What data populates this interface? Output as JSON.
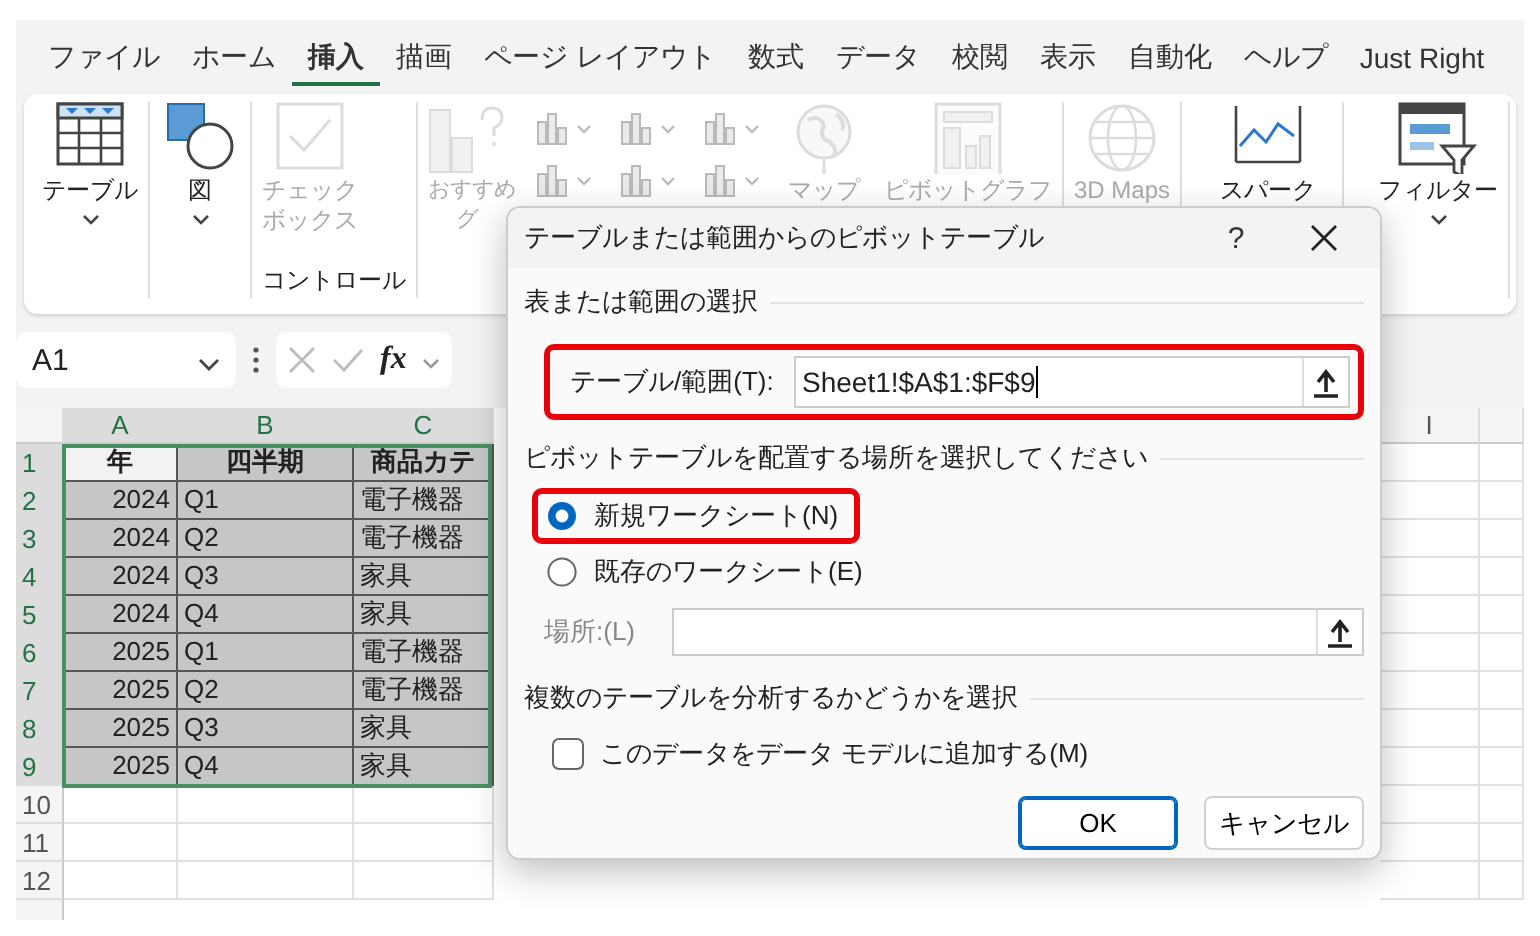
{
  "menu_tabs": [
    {
      "label": "ファイル",
      "selected": false
    },
    {
      "label": "ホーム",
      "selected": false
    },
    {
      "label": "挿入",
      "selected": true
    },
    {
      "label": "描画",
      "selected": false
    },
    {
      "label": "ページ レイアウト",
      "selected": false
    },
    {
      "label": "数式",
      "selected": false
    },
    {
      "label": "データ",
      "selected": false
    },
    {
      "label": "校閲",
      "selected": false
    },
    {
      "label": "表示",
      "selected": false
    },
    {
      "label": "自動化",
      "selected": false
    },
    {
      "label": "ヘルプ",
      "selected": false
    },
    {
      "label": "Just Right",
      "selected": false
    }
  ],
  "ribbon": {
    "groups": [
      {
        "items": [
          {
            "kind": "table",
            "lines": [
              "テーブル"
            ],
            "dropdown": true,
            "disabled": false
          }
        ]
      },
      {
        "items": [
          {
            "kind": "shapes",
            "lines": [
              "図"
            ],
            "dropdown": true,
            "disabled": false
          }
        ]
      },
      {
        "label": "コントロール",
        "items": [
          {
            "kind": "checkbox",
            "lines": [
              "チェック",
              "ボックス"
            ],
            "dropdown": false,
            "disabled": true
          }
        ]
      },
      {
        "items": [
          {
            "kind": "recommended-chart",
            "lines": [
              "おすすめ",
              "グ"
            ],
            "dropdown": false,
            "disabled": true
          },
          {
            "kind": "chart-grid",
            "dropdown": false,
            "disabled": true
          },
          {
            "kind": "globe",
            "lines": [
              "マップ"
            ],
            "dropdown": false,
            "disabled": true
          },
          {
            "kind": "pivot-chart",
            "lines": [
              "ピボットグラフ"
            ],
            "dropdown": false,
            "disabled": true
          }
        ]
      },
      {
        "items": [
          {
            "kind": "globe-grid",
            "lines": [
              "3D Maps"
            ],
            "dropdown": false,
            "disabled": true
          }
        ]
      },
      {
        "items": [
          {
            "kind": "sparkline",
            "lines": [
              "スパーク"
            ],
            "dropdown": false,
            "disabled": false
          }
        ]
      },
      {
        "items": [
          {
            "kind": "filter",
            "lines": [
              "フィルター"
            ],
            "dropdown": true,
            "disabled": false
          }
        ]
      }
    ]
  },
  "formula_bar": {
    "name_box": "A1",
    "function_label": "fx"
  },
  "sheet": {
    "columns": [
      "A",
      "B",
      "C",
      "I"
    ],
    "rows": [
      {
        "number": "1",
        "selected": true,
        "kind": "header",
        "cells": [
          {
            "text": "年",
            "active": true
          },
          {
            "text": "四半期",
            "active": false
          },
          {
            "text": "商品カテ",
            "active": false
          }
        ]
      },
      {
        "number": "2",
        "selected": true,
        "kind": "data",
        "cells": [
          {
            "text": "2024",
            "active": false
          },
          {
            "text": "Q1",
            "active": false
          },
          {
            "text": "電子機器",
            "active": false
          }
        ]
      },
      {
        "number": "3",
        "selected": true,
        "kind": "data",
        "cells": [
          {
            "text": "2024",
            "active": false
          },
          {
            "text": "Q2",
            "active": false
          },
          {
            "text": "電子機器",
            "active": false
          }
        ]
      },
      {
        "number": "4",
        "selected": true,
        "kind": "data",
        "cells": [
          {
            "text": "2024",
            "active": false
          },
          {
            "text": "Q3",
            "active": false
          },
          {
            "text": "家具",
            "active": false
          }
        ]
      },
      {
        "number": "5",
        "selected": true,
        "kind": "data",
        "cells": [
          {
            "text": "2024",
            "active": false
          },
          {
            "text": "Q4",
            "active": false
          },
          {
            "text": "家具",
            "active": false
          }
        ]
      },
      {
        "number": "6",
        "selected": true,
        "kind": "data",
        "cells": [
          {
            "text": "2025",
            "active": false
          },
          {
            "text": "Q1",
            "active": false
          },
          {
            "text": "電子機器",
            "active": false
          }
        ]
      },
      {
        "number": "7",
        "selected": true,
        "kind": "data",
        "cells": [
          {
            "text": "2025",
            "active": false
          },
          {
            "text": "Q2",
            "active": false
          },
          {
            "text": "電子機器",
            "active": false
          }
        ]
      },
      {
        "number": "8",
        "selected": true,
        "kind": "data",
        "cells": [
          {
            "text": "2025",
            "active": false
          },
          {
            "text": "Q3",
            "active": false
          },
          {
            "text": "家具",
            "active": false
          }
        ]
      },
      {
        "number": "9",
        "selected": true,
        "kind": "data",
        "cells": [
          {
            "text": "2025",
            "active": false
          },
          {
            "text": "Q4",
            "active": false
          },
          {
            "text": "家具",
            "active": false
          }
        ]
      },
      {
        "number": "10",
        "selected": false,
        "kind": "data",
        "cells": []
      },
      {
        "number": "11",
        "selected": false,
        "kind": "data",
        "cells": []
      },
      {
        "number": "12",
        "selected": false,
        "kind": "data",
        "cells": []
      }
    ]
  },
  "dialog": {
    "title": "テーブルまたは範囲からのピボットテーブル",
    "help": "?",
    "source_heading": "表または範囲の選択",
    "range_field": {
      "label": "テーブル/範囲(T):",
      "value": "Sheet1!$A$1:$F$9",
      "highlighted": true
    },
    "placement_heading": "ピボットテーブルを配置する場所を選択してください",
    "placement_options": [
      {
        "label": "新規ワークシート(N)",
        "selected": true,
        "highlighted": true
      },
      {
        "label": "既存のワークシート(E)",
        "selected": false,
        "highlighted": false
      }
    ],
    "location_field": {
      "label": "場所:(L)",
      "disabled": true
    },
    "multi_heading": "複数のテーブルを分析するかどうかを選択",
    "data_model_checkbox": {
      "label": "このデータをデータ モデルに追加する(M)",
      "checked": false
    },
    "buttons": [
      {
        "label": "OK",
        "kind": "default"
      },
      {
        "label": "キャンセル",
        "kind": "normal"
      }
    ]
  }
}
